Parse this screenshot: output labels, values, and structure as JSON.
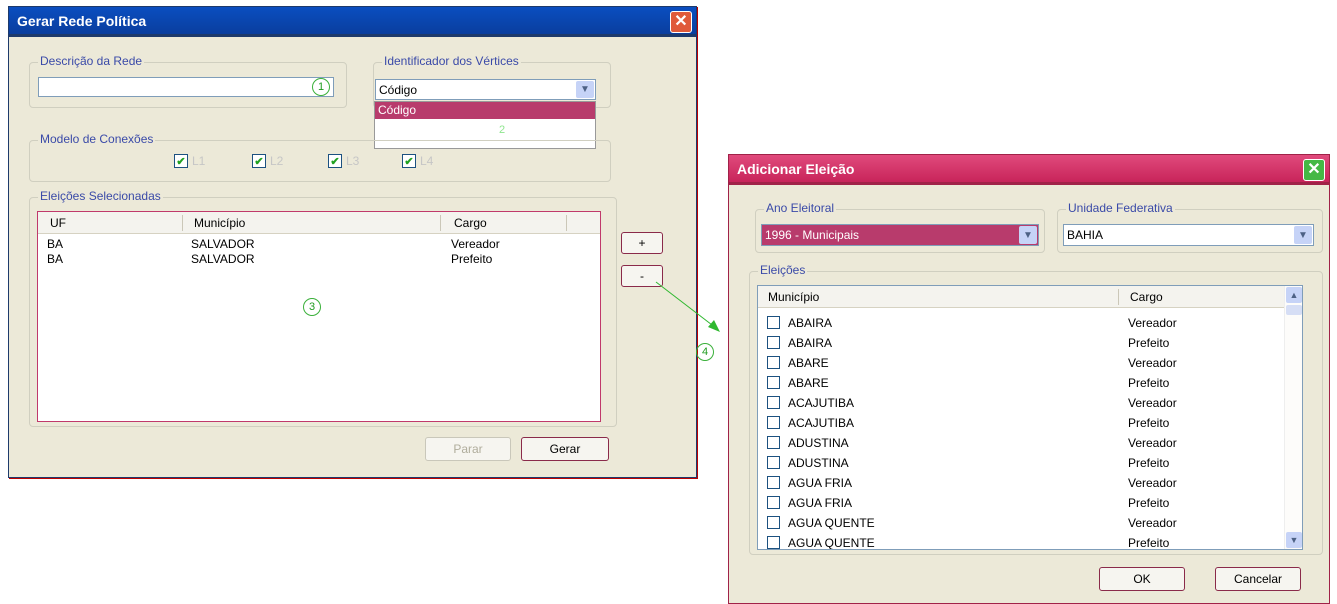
{
  "main_window": {
    "title": "Gerar Rede Política",
    "close_label": "✕",
    "descricao": {
      "label": "Descrição da Rede",
      "value": ""
    },
    "identificador": {
      "label": "Identificador dos Vértices",
      "selected": "Código",
      "options_visible": [
        "Código"
      ]
    },
    "modelo": {
      "label": "Modelo de Conexões",
      "checkboxes": [
        {
          "label": "L1",
          "checked": true
        },
        {
          "label": "L2",
          "checked": true
        },
        {
          "label": "L3",
          "checked": true
        },
        {
          "label": "L4",
          "checked": true
        }
      ]
    },
    "eleicoes": {
      "label": "Eleições Selecionadas",
      "columns": [
        "UF",
        "Município",
        "Cargo"
      ],
      "rows": [
        {
          "uf": "BA",
          "municipio": "SALVADOR",
          "cargo": "Vereador"
        },
        {
          "uf": "BA",
          "municipio": "SALVADOR",
          "cargo": "Prefeito"
        }
      ]
    },
    "add_button": "+",
    "remove_button": "-",
    "parar_button": "Parar",
    "gerar_button": "Gerar"
  },
  "annotations": {
    "one": "1",
    "two": "2",
    "three": "3",
    "four": "4"
  },
  "dialog": {
    "title": "Adicionar Eleição",
    "close_label": "✕",
    "ano": {
      "label": "Ano Eleitoral",
      "value": "1996 - Municipais"
    },
    "uf": {
      "label": "Unidade Federativa",
      "value": "BAHIA"
    },
    "eleicoes": {
      "label": "Eleições",
      "columns": [
        "Município",
        "Cargo"
      ],
      "rows": [
        {
          "municipio": "ABAIRA",
          "cargo": "Vereador"
        },
        {
          "municipio": "ABAIRA",
          "cargo": "Prefeito"
        },
        {
          "municipio": "ABARE",
          "cargo": "Vereador"
        },
        {
          "municipio": "ABARE",
          "cargo": "Prefeito"
        },
        {
          "municipio": "ACAJUTIBA",
          "cargo": "Vereador"
        },
        {
          "municipio": "ACAJUTIBA",
          "cargo": "Prefeito"
        },
        {
          "municipio": "ADUSTINA",
          "cargo": "Vereador"
        },
        {
          "municipio": "ADUSTINA",
          "cargo": "Prefeito"
        },
        {
          "municipio": "AGUA FRIA",
          "cargo": "Vereador"
        },
        {
          "municipio": "AGUA FRIA",
          "cargo": "Prefeito"
        },
        {
          "municipio": "AGUA QUENTE",
          "cargo": "Vereador"
        },
        {
          "municipio": "AGUA QUENTE",
          "cargo": "Prefeito"
        }
      ]
    },
    "ok_button": "OK",
    "cancel_button": "Cancelar"
  },
  "colors": {
    "xp_blue": "#0a4ec0",
    "dialog_pink": "#d8356a",
    "selection": "#b83b6c",
    "annotation_green": "#1f9b1f"
  }
}
